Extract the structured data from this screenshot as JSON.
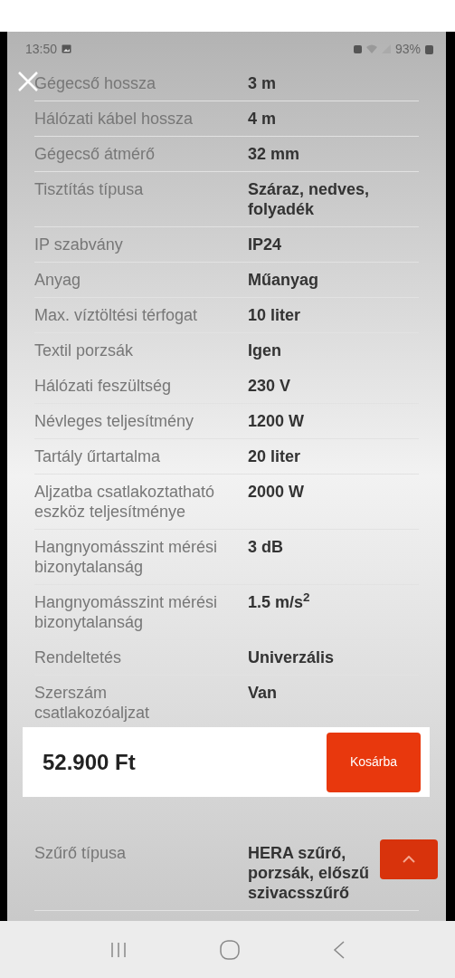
{
  "status_bar": {
    "time": "13:50",
    "battery": "93%"
  },
  "specs": [
    {
      "label": "Gégecső hossza",
      "value": "3 m"
    },
    {
      "label": "Hálózati kábel hossza",
      "value": "4 m"
    },
    {
      "label": "Gégecső átmérő",
      "value": "32 mm"
    },
    {
      "label": "Tisztítás típusa",
      "value": "Száraz, nedves, folyadék"
    },
    {
      "label": "IP szabvány",
      "value": "IP24"
    },
    {
      "label": "Anyag",
      "value": "Műanyag"
    },
    {
      "label": "Max. víztöltési térfogat",
      "value": "10 liter"
    },
    {
      "label": "Textil porzsák",
      "value": "Igen"
    },
    {
      "label": "Hálózati feszültség",
      "value": "230 V"
    },
    {
      "label": "Névleges teljesítmény",
      "value": "1200 W"
    },
    {
      "label": "Tartály űrtartalma",
      "value": "20 liter"
    },
    {
      "label": "Aljzatba csatlakoztatható eszköz teljesítménye",
      "value": "2000 W"
    },
    {
      "label": "Hangnyomásszint mérési bizonytalanság",
      "value": "3 dB"
    },
    {
      "label": "Hangnyomásszint mérési bizonytalanság",
      "value": "1.5 m/s$^{2}$"
    },
    {
      "label": "Rendeltetés",
      "value": "Univerzális"
    },
    {
      "label": "Szerszám csatlakozóaljzat",
      "value": "Van"
    }
  ],
  "price_bar": {
    "price": "52.900 Ft",
    "button": "Kosárba"
  },
  "more_specs": [
    {
      "label": "Szűrő típusa",
      "value": "HERA szűrő, porzsák, előszű szivacsszűrő"
    }
  ]
}
